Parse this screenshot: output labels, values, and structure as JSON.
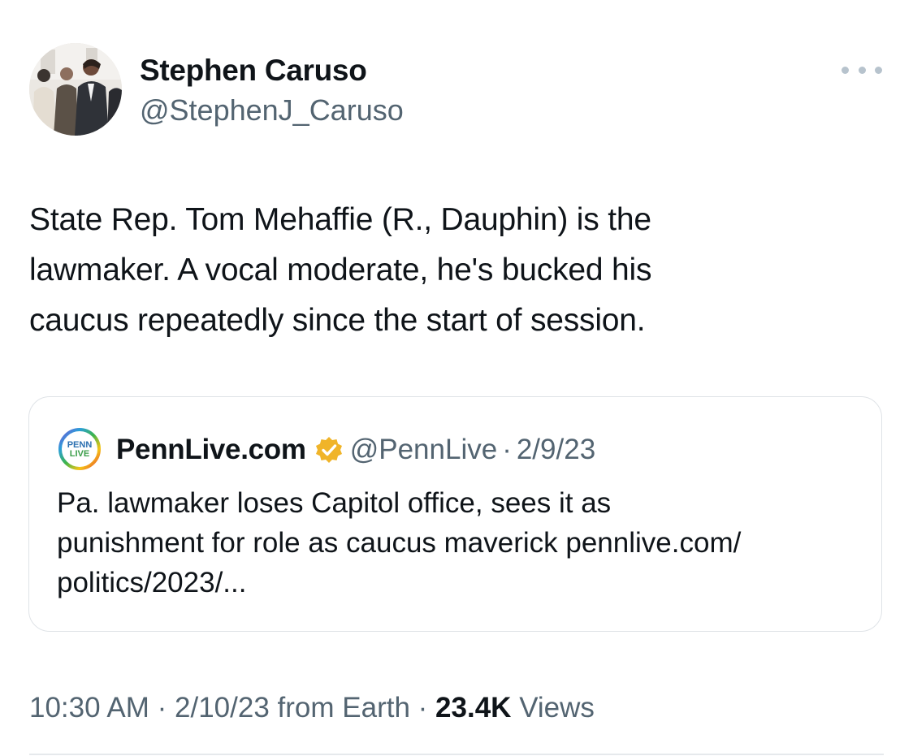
{
  "author": {
    "name": "Stephen Caruso",
    "handle": "@StephenJ_Caruso",
    "avatar_icon": "profile-photo"
  },
  "more_icon": "more-horizontal-icon",
  "tweet": {
    "lines": [
      "State Rep. Tom Mehaffie (R., Dauphin) is the",
      "lawmaker. A vocal moderate, he's bucked his",
      "caucus repeatedly since the start of session."
    ]
  },
  "quote": {
    "logo_text": [
      "PENN",
      "LIVE"
    ],
    "name": "PennLive.com",
    "verified_badge_color": "#f0b429",
    "handle": "@PennLive",
    "separator": "·",
    "date": "2/9/23",
    "lines": [
      "Pa. lawmaker loses Capitol office, sees it as",
      "punishment for role as caucus maverick pennlive.com/",
      "politics/2023/..."
    ]
  },
  "meta": {
    "time": "10:30 AM",
    "separator": "·",
    "date": "2/10/23",
    "source": "from Earth",
    "views_count": "23.4K",
    "views_label": "Views"
  },
  "colors": {
    "text_primary": "#0f1419",
    "text_secondary": "#536471",
    "border": "#dfe3e7"
  }
}
